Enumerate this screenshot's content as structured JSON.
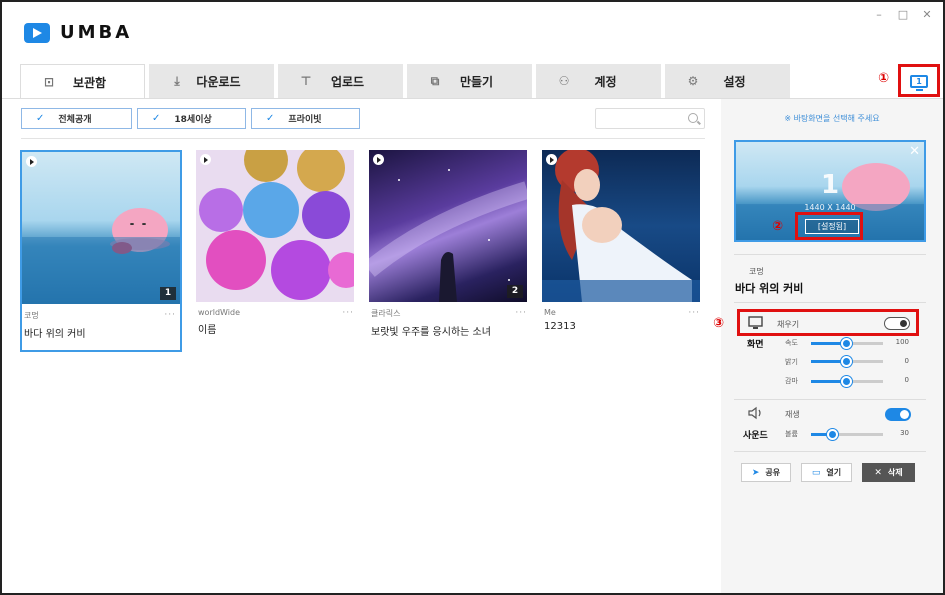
{
  "app": {
    "name": "UMBA"
  },
  "window_controls": {
    "minimize": "–",
    "maximize": "□",
    "close": "✕"
  },
  "tabs": [
    {
      "label": "보관함",
      "icon": "library-icon",
      "glyph": "⊡"
    },
    {
      "label": "다운로드",
      "icon": "download-icon",
      "glyph": "⤓"
    },
    {
      "label": "업로드",
      "icon": "upload-icon",
      "glyph": "⊤"
    },
    {
      "label": "만들기",
      "icon": "create-icon",
      "glyph": "⧉"
    },
    {
      "label": "계정",
      "icon": "account-icon",
      "glyph": "⚇"
    },
    {
      "label": "설정",
      "icon": "settings-icon",
      "glyph": "⚙"
    }
  ],
  "monitor_button": {
    "label": "1"
  },
  "annotations": {
    "one": "①",
    "two": "②",
    "three": "③"
  },
  "filters": [
    {
      "label": "전체공개",
      "check": "✓"
    },
    {
      "label": "18세이상",
      "check": "✓"
    },
    {
      "label": "프라이빗",
      "check": "✓"
    }
  ],
  "search": {
    "placeholder": "",
    "value": ""
  },
  "cards": [
    {
      "author": "코멍",
      "title": "바다 위의 커비",
      "badge": "1",
      "more": "···"
    },
    {
      "author": "worldWide",
      "title": "이름",
      "badge": "",
      "more": "···"
    },
    {
      "author": "클라릭스",
      "title": "보랏빛 우주를 응시하는 소녀",
      "badge": "2",
      "more": "···"
    },
    {
      "author": "Me",
      "title": "12313",
      "badge": "",
      "more": "···"
    }
  ],
  "right_panel": {
    "hint": "※ 바탕화면을 선택해 주세요",
    "preview": {
      "number": "1",
      "resolution": "1440 X 1440",
      "set_button": "[설정됨]",
      "close": "✕"
    },
    "author": "코멍",
    "title": "바다 위의 커비",
    "fill_label": "채우기",
    "fill_on": false,
    "screen_section": "화면",
    "sliders": [
      {
        "name": "속도",
        "value": "100",
        "level": 0.5
      },
      {
        "name": "밝기",
        "value": "0",
        "level": 0.5
      },
      {
        "name": "감마",
        "value": "0",
        "level": 0.5
      }
    ],
    "play_label": "재생",
    "play_on": true,
    "sound_section": "사운드",
    "volume": {
      "name": "볼륨",
      "value": "30",
      "level": 0.3
    },
    "actions": {
      "share": "공유",
      "open": "열기",
      "delete": "삭제"
    }
  },
  "colors": {
    "accent": "#1e88e5",
    "highlight": "#e01010"
  }
}
